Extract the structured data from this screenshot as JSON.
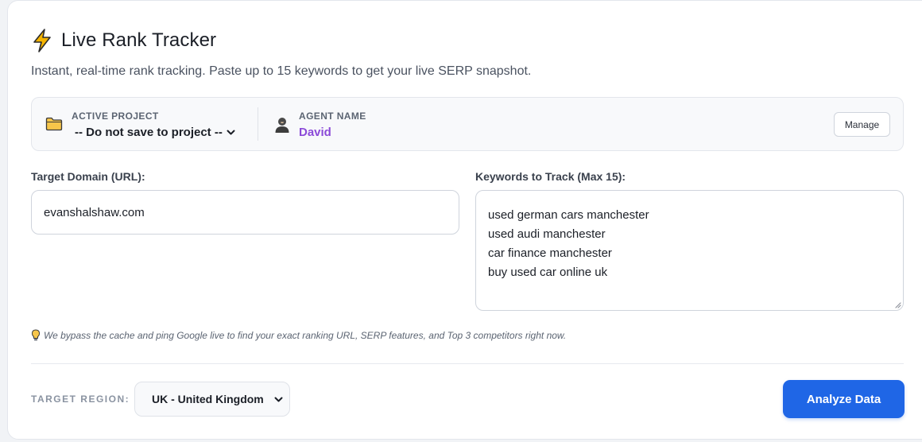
{
  "header": {
    "title": "Live Rank Tracker",
    "icon": "lightning-bolt-icon",
    "subtitle": "Instant, real-time rank tracking. Paste up to 15 keywords to get your live SERP snapshot."
  },
  "project_bar": {
    "project_label": "ACTIVE PROJECT",
    "project_value": "-- Do not save to project --",
    "agent_label": "AGENT NAME",
    "agent_value": "David",
    "manage_label": "Manage"
  },
  "form": {
    "domain_label": "Target Domain (URL):",
    "domain_value": "evanshalshaw.com",
    "keywords_label": "Keywords to Track (Max 15):",
    "keywords": [
      "used german cars manchester",
      "used audi manchester",
      "car finance manchester",
      "buy used car online uk"
    ]
  },
  "hint": "We bypass the cache and ping Google live to find your exact ranking URL, SERP features, and Top 3 competitors right now.",
  "footer": {
    "region_label": "TARGET REGION:",
    "region_value": "UK - United Kingdom",
    "analyze_label": "Analyze Data"
  },
  "colors": {
    "accent": "#1f66e6",
    "agent_name": "#8b4ad8",
    "bolt": "#f5b400",
    "folder": "#f7c64a"
  }
}
